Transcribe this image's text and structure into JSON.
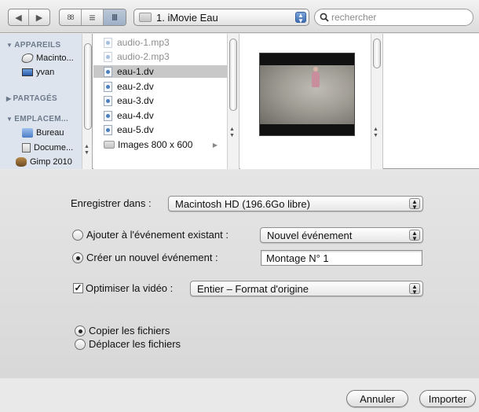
{
  "toolbar": {
    "back_glyph": "◀",
    "forward_glyph": "▶",
    "view_icons_glyph": "88",
    "view_list_glyph": "≡",
    "view_columns_glyph": "Ⅲ",
    "path_label": "1. iMovie  Eau",
    "search_placeholder": "rechercher"
  },
  "sidebar": {
    "sections": [
      {
        "label": "APPAREILS",
        "items": [
          {
            "label": "Macinto...",
            "icon": "disk-icon"
          },
          {
            "label": "yvan",
            "icon": "computer-icon"
          }
        ]
      },
      {
        "label": "PARTAGÉS",
        "items": []
      },
      {
        "label": "EMPLACEM...",
        "items": [
          {
            "label": "Bureau",
            "icon": "desktop-icon"
          },
          {
            "label": "Docume...",
            "icon": "documents-icon"
          },
          {
            "label": "Gimp 2010",
            "icon": "gimp-icon"
          }
        ]
      }
    ]
  },
  "files": [
    {
      "name": "audio-1.mp3",
      "dim": true
    },
    {
      "name": "audio-2.mp3",
      "dim": true
    },
    {
      "name": "eau-1.dv",
      "selected": true
    },
    {
      "name": "eau-2.dv"
    },
    {
      "name": "eau-3.dv"
    },
    {
      "name": "eau-4.dv"
    },
    {
      "name": "eau-5.dv"
    },
    {
      "name": "Images 800 x 600",
      "folder": true
    }
  ],
  "options": {
    "save_in_label": "Enregistrer dans :",
    "save_in_value": "Macintosh HD (196.6Go libre)",
    "add_existing_label": "Ajouter à l'événement existant :",
    "add_existing_value": "Nouvel événement",
    "new_event_label": "Créer un nouvel événement :",
    "new_event_value": "Montage N° 1",
    "optimize_label": "Optimiser la vidéo :",
    "optimize_value": "Entier – Format d'origine",
    "copy_label": "Copier les fichiers",
    "move_label": "Déplacer les fichiers"
  },
  "buttons": {
    "cancel": "Annuler",
    "import": "Importer"
  },
  "colors": {
    "selection": "#c8c8c8",
    "sidebar_bg": "#dde4ed",
    "accent": "#3d6cb2"
  }
}
